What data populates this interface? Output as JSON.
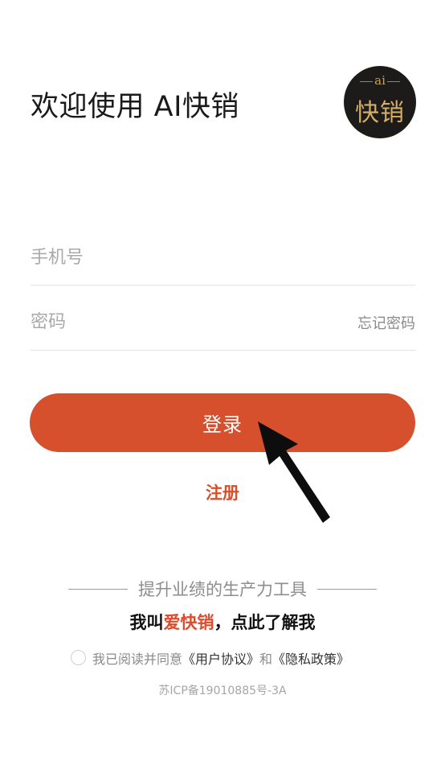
{
  "header": {
    "welcome_title": "欢迎使用 AI快销"
  },
  "logo": {
    "top_text": "ai",
    "name": "快销"
  },
  "form": {
    "phone_placeholder": "手机号",
    "phone_value": "",
    "password_placeholder": "密码",
    "password_value": "",
    "forgot_password": "忘记密码",
    "login_label": "登录",
    "register_label": "注册"
  },
  "footer": {
    "slogan": "提升业绩的生产力工具",
    "intro_prefix": "我叫",
    "intro_brand": "爱快销",
    "intro_suffix": "，点此了解我",
    "agree_prefix": "我已阅读并同意",
    "user_agreement": "《用户协议》",
    "agree_and": "和",
    "privacy_policy": "《隐私政策》",
    "agree_checked": false,
    "icp": "苏ICP备19010885号-3A"
  },
  "colors": {
    "accent": "#d6502e",
    "brand_text": "#e24a2c",
    "logo_bg": "#1c1b19",
    "logo_gold": "#d4ad66"
  }
}
